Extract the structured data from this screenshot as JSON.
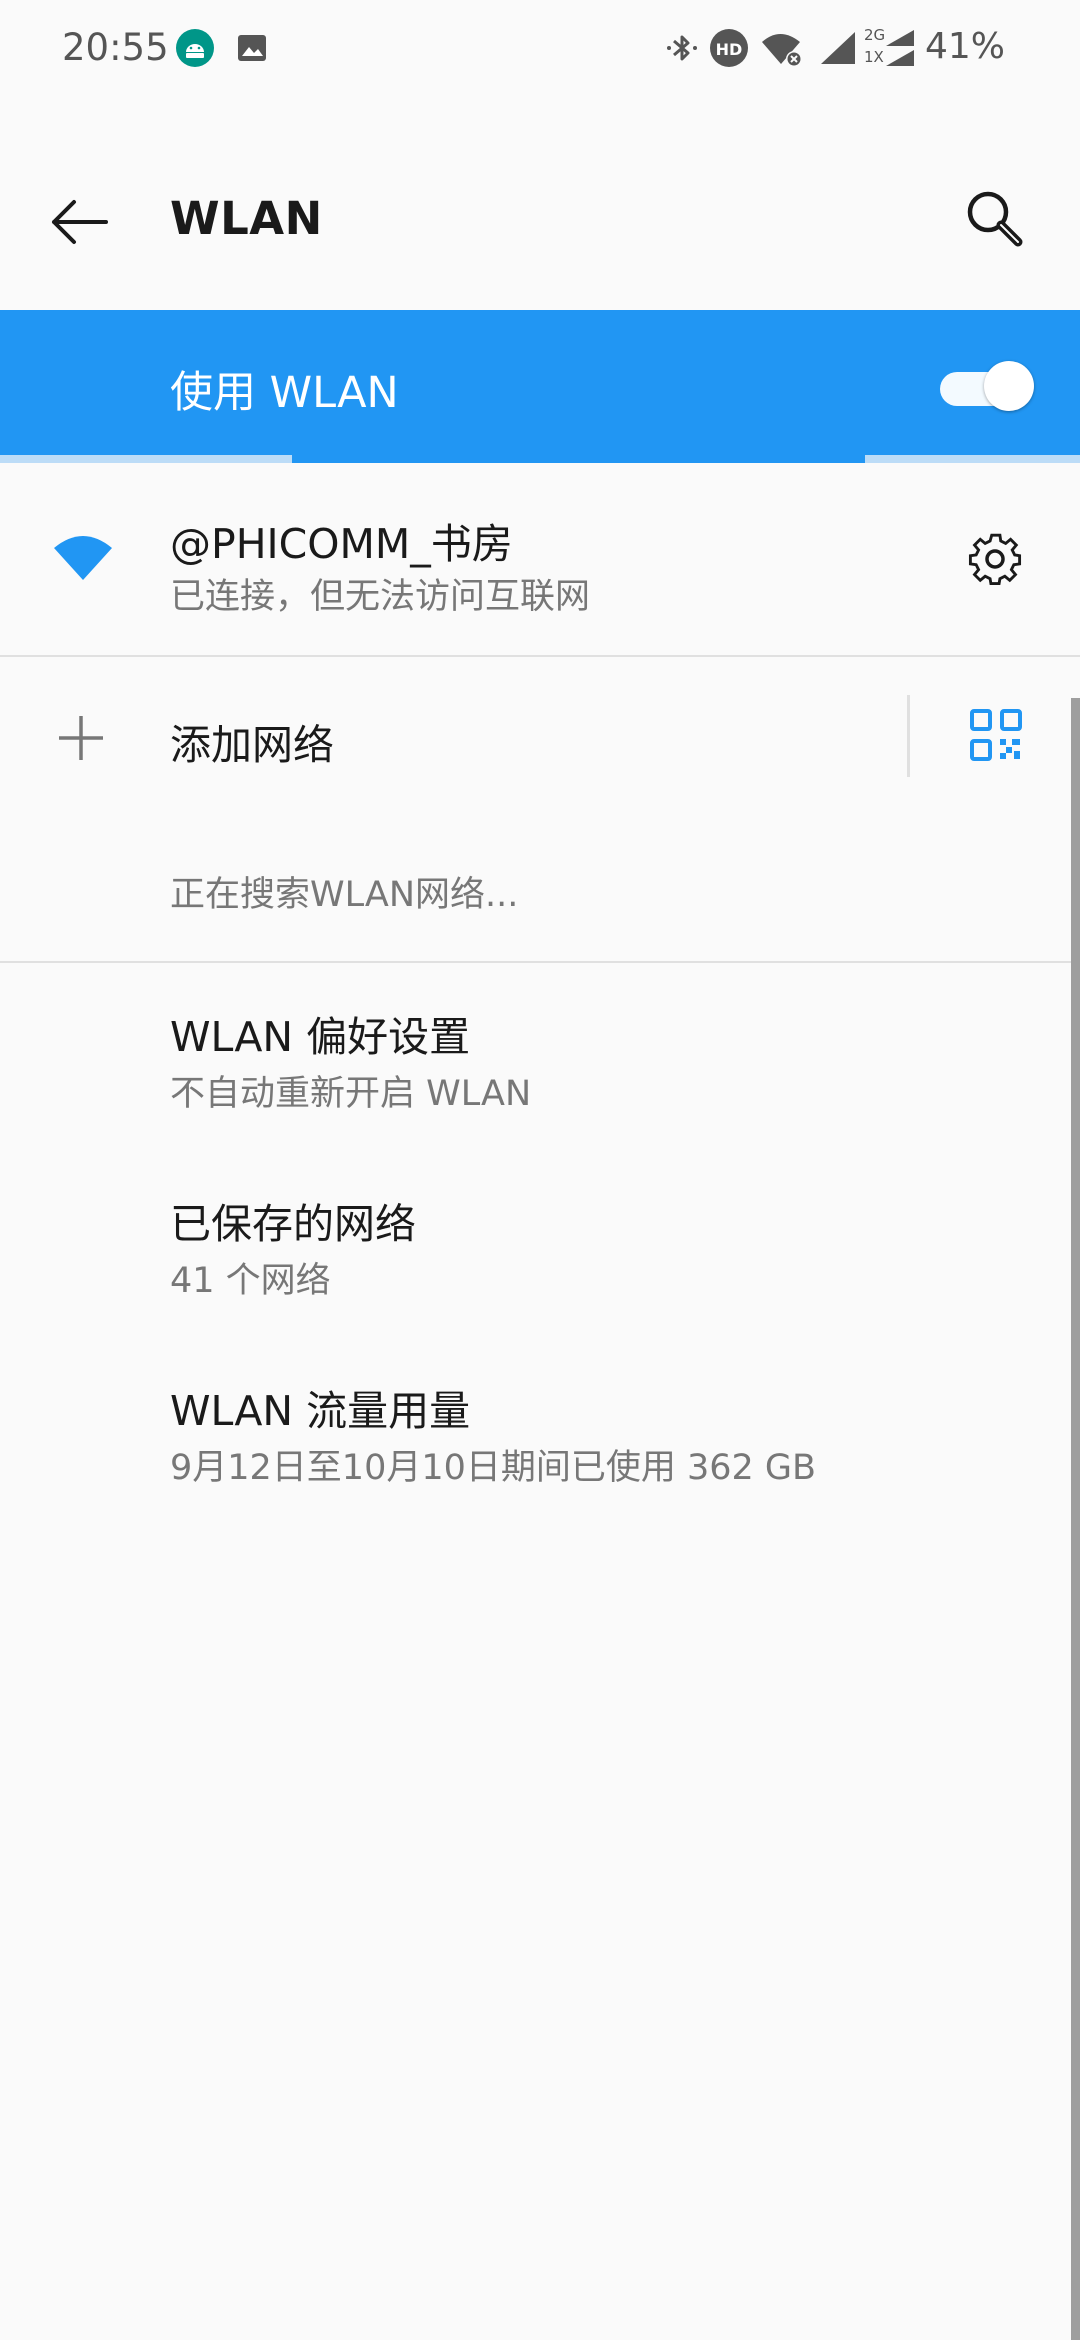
{
  "status_bar": {
    "time": "20:55",
    "left_icons": [
      "android-icon",
      "image-icon"
    ],
    "right_icons": [
      "bluetooth-icon",
      "hd-icon",
      "wifi-off-icon",
      "signal-icon",
      "signal-2g-icon"
    ],
    "network_label_top": "2G",
    "network_label_bottom": "1X",
    "hd_label": "HD",
    "battery": "41%"
  },
  "app_bar": {
    "title": "WLAN",
    "back_icon": "back-arrow-icon",
    "search_icon": "search-icon"
  },
  "master_switch": {
    "label": "使用 WLAN",
    "enabled": true
  },
  "colors": {
    "accent": "#2196f3",
    "text_primary": "#1a1a1a",
    "text_secondary": "#777777",
    "background": "#fafafa"
  },
  "connected_network": {
    "name": "@PHICOMM_书房",
    "status": "已连接，但无法访问互联网",
    "icon": "wifi-icon",
    "settings_icon": "gear-icon"
  },
  "add_network": {
    "label": "添加网络",
    "icon": "plus-icon",
    "qr_icon": "qr-code-icon"
  },
  "scanning_text": "正在搜索WLAN网络...",
  "preferences": [
    {
      "title": "WLAN 偏好设置",
      "subtitle": "不自动重新开启 WLAN"
    },
    {
      "title": "已保存的网络",
      "subtitle": "41 个网络"
    },
    {
      "title": "WLAN 流量用量",
      "subtitle": "9月12日至10月10日期间已使用 362 GB"
    }
  ]
}
